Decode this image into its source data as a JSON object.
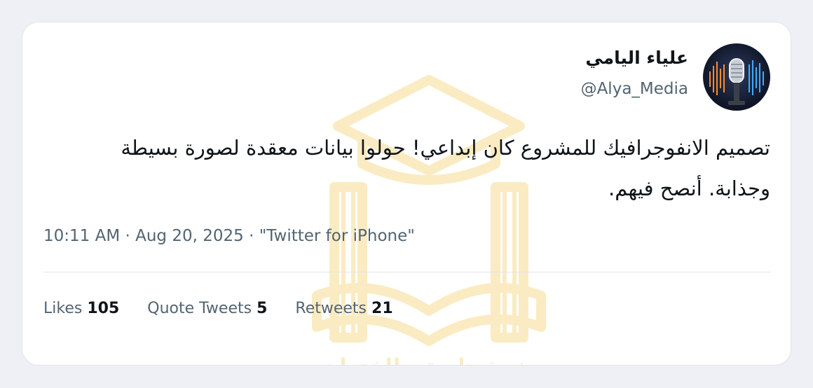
{
  "tweet": {
    "author_name": "علياء اليامي",
    "handle": "@Alya_Media",
    "text": "تصميم الانفوجرافيك للمشروع كان إبداعي! حولوا بيانات معقدة لصورة بسيطة وجذابة. أنصح فيهم.",
    "time": "10:11 AM",
    "date": "Aug 20, 2025",
    "source": "\"Twitter for iPhone\"",
    "separator": "·"
  },
  "stats": {
    "likes_label": "Likes",
    "likes_value": "105",
    "quote_label": "Quote Tweets",
    "quote_value": "5",
    "retweets_label": "Retweets",
    "retweets_value": "21"
  },
  "watermark": {
    "text": "منصة جامعتي للخدمات الطلابية",
    "color": "#f6dc92"
  },
  "colors": {
    "background": "#eef0f5",
    "card": "#ffffff",
    "text_primary": "#0f1419",
    "text_secondary": "#536471",
    "divider": "#e1e4ea"
  }
}
